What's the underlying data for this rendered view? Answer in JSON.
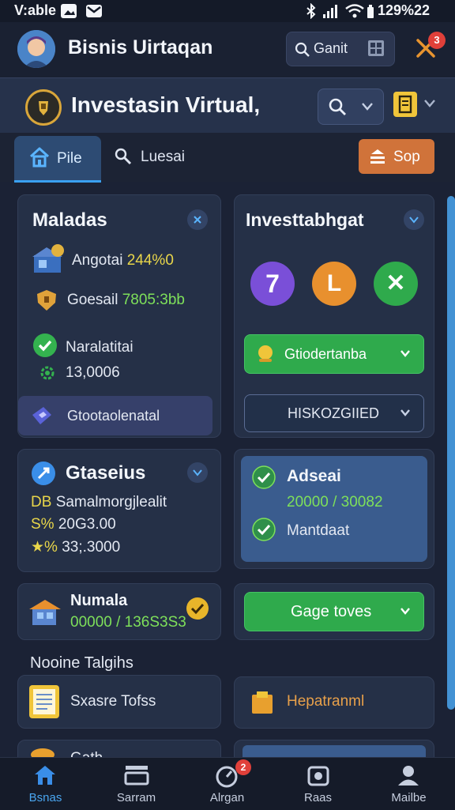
{
  "status_bar": {
    "left_text": "V:able",
    "right_text": "129%22"
  },
  "header": {
    "title": "Bisnis Uirtaqan",
    "search_label": "Ganit",
    "notification_count": "3"
  },
  "subheader": {
    "title": "Investasin Virtual,"
  },
  "tabs": {
    "active_label": "Pile",
    "second_label": "Luesai",
    "sort_label": "Sop"
  },
  "cards": {
    "maladas": {
      "title": "Maladas",
      "row1_label": "Angotai",
      "row1_value": "244%0",
      "row2_label": "Goesail",
      "row2_value": "7805:3bb",
      "row3_label": "Naralatitai",
      "row3_value": "13,0006",
      "button_label": "Gtootaolenatal"
    },
    "investabhgat": {
      "title": "Investtabhgat",
      "badges": [
        "7",
        "L",
        "✕"
      ],
      "green_button": "Gtiodertanba",
      "outline_button": "HISKOZGIIED"
    },
    "gtaseius": {
      "title": "Gtaseius",
      "row1_prefix": "DB",
      "row1_text": "Samalmorgjlealit",
      "row2_prefix": "S%",
      "row2_value": "20G3.00",
      "row3_prefix": "★%",
      "row3_value": "33;.3000"
    },
    "adseai": {
      "title": "Adseai",
      "value": "20000 / 30082",
      "row2_label": "Mantdaat"
    },
    "numala": {
      "title": "Numala",
      "value": "00000 / 136S3S3"
    },
    "gage": {
      "button_label": "Gage toves"
    },
    "moone": {
      "title": "Nooine Talgihs",
      "item_label": "Sxasre Tofss"
    },
    "hepa": {
      "label": "Hepatranml"
    },
    "partial_left": {
      "label": "Gath..."
    }
  },
  "bottom_nav": [
    {
      "label": "Bsnas"
    },
    {
      "label": "Sarram"
    },
    {
      "label": "Alrgan",
      "badge": "2"
    },
    {
      "label": "Raas"
    },
    {
      "label": "Mailbe"
    }
  ],
  "colors": {
    "background": "#1b2235",
    "card": "#253047",
    "accent_blue": "#3aa0f0",
    "green": "#2faa4c",
    "orange": "#d0733a",
    "gold": "#f0c53a",
    "purple": "#7a4fd8"
  }
}
